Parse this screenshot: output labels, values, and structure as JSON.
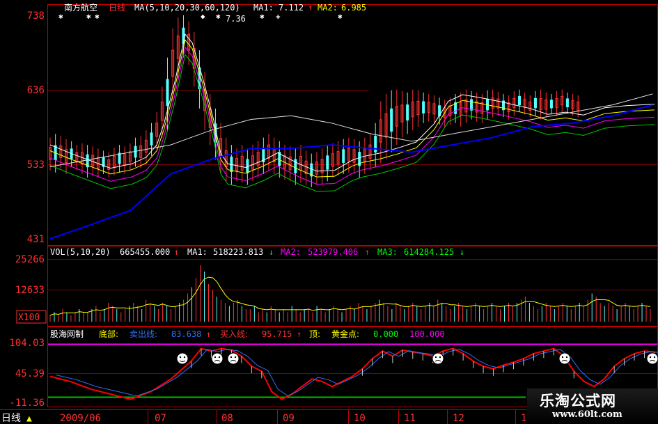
{
  "colors": {
    "frame": "#c00000",
    "ma1": "#ffffff",
    "ma2": "#ffff00",
    "ma3": "#ff00ff",
    "ma4": "#00c800",
    "ma5": "#e0e0e0",
    "ma6": "#0000ff",
    "up": "#ff3232",
    "down": "#54ffff",
    "ind_main": "#ff0000",
    "ind_sub": "#3070ff",
    "ind_top": "#ff00ff",
    "ind_bottom": "#00c000"
  },
  "main_panel": {
    "stock_name": "南方航空",
    "period": "日线",
    "ma_header": "MA(5,10,20,30,60,120)",
    "ma1_label": "MA1:",
    "ma1_value": "7.112",
    "ma1_arrow": "↑",
    "ma2_label": "MA2:",
    "ma2_value": "6.985",
    "peak_label": "7.36",
    "y_ticks": [
      "738",
      "636",
      "533",
      "431"
    ]
  },
  "vol_panel": {
    "header": "VOL(5,10,20)",
    "vol_value": "665455.000",
    "vol_arrow": "↑",
    "ma1_label": "MA1:",
    "ma1_value": "518223.813",
    "ma1_arrow": "↓",
    "ma2_label": "MA2:",
    "ma2_value": "523979.406",
    "ma2_arrow": "↑",
    "ma3_label": "MA3:",
    "ma3_value": "614284.125",
    "ma3_arrow": "↓",
    "y_ticks": [
      "25266",
      "12633"
    ],
    "unit": "X100"
  },
  "indicator_panel": {
    "name": "股海网制",
    "bottom_label": "底部:",
    "sell_label": "卖出线:",
    "sell_value": "83.638",
    "sell_arrow": "↑",
    "buy_label": "买入线:",
    "buy_value": "95.715",
    "buy_arrow": "↑",
    "top_label": "顶:",
    "gold_label": "黄金点:",
    "gold_value": "0.000",
    "extra_value": "100.000",
    "y_ticks": [
      "104.03",
      "45.39",
      "-11.36"
    ]
  },
  "x_axis": {
    "period_button": "日线",
    "labels": [
      "2009/06",
      "07",
      "08",
      "09",
      "10",
      "11",
      "12",
      "1"
    ]
  },
  "watermark": {
    "title": "乐淘公式网",
    "url": "www.60lt.com"
  },
  "chart_data": [
    {
      "type": "candlestick",
      "series": [
        {
          "name": "MA1",
          "values": []
        },
        {
          "name": "MA2",
          "values": []
        }
      ],
      "y_ticks": [
        738,
        636,
        533,
        431
      ],
      "ylim": [
        431,
        738
      ],
      "peak_value": 7.36,
      "grid": true,
      "close_path": [
        [
          0,
          560
        ],
        [
          12,
          548
        ],
        [
          22,
          539
        ],
        [
          34,
          528
        ],
        [
          46,
          534
        ],
        [
          54,
          543
        ],
        [
          60,
          560
        ],
        [
          64,
          589
        ],
        [
          70,
          645
        ],
        [
          76,
          712
        ],
        [
          80,
          700
        ],
        [
          86,
          650
        ],
        [
          92,
          594
        ],
        [
          96,
          548
        ],
        [
          100,
          534
        ],
        [
          110,
          529
        ],
        [
          120,
          539
        ],
        [
          128,
          549
        ],
        [
          140,
          534
        ],
        [
          150,
          524
        ],
        [
          160,
          525
        ],
        [
          170,
          539
        ],
        [
          176,
          544
        ],
        [
          186,
          549
        ],
        [
          196,
          556
        ],
        [
          206,
          564
        ],
        [
          216,
          589
        ],
        [
          224,
          620
        ],
        [
          232,
          629
        ],
        [
          242,
          625
        ],
        [
          254,
          619
        ],
        [
          270,
          610
        ],
        [
          280,
          602
        ],
        [
          290,
          605
        ],
        [
          300,
          601
        ],
        [
          312,
          611
        ],
        [
          324,
          614
        ],
        [
          340,
          616
        ]
      ],
      "wick_spans": [
        [
          0,
          525,
          570
        ],
        [
          3,
          522,
          575
        ],
        [
          6,
          528,
          572
        ],
        [
          9,
          520,
          568
        ],
        [
          12,
          530,
          565
        ],
        [
          15,
          525,
          560
        ],
        [
          18,
          520,
          562
        ],
        [
          21,
          515,
          560
        ],
        [
          24,
          518,
          558
        ],
        [
          27,
          515,
          555
        ],
        [
          30,
          520,
          552
        ],
        [
          33,
          515,
          550
        ],
        [
          36,
          518,
          556
        ],
        [
          39,
          522,
          560
        ],
        [
          42,
          520,
          558
        ],
        [
          45,
          525,
          562
        ],
        [
          48,
          530,
          570
        ],
        [
          51,
          528,
          572
        ],
        [
          54,
          535,
          580
        ],
        [
          57,
          545,
          590
        ],
        [
          60,
          555,
          605
        ],
        [
          63,
          570,
          640
        ],
        [
          66,
          580,
          680
        ],
        [
          69,
          620,
          720
        ],
        [
          72,
          650,
          735
        ],
        [
          75,
          680,
          738
        ],
        [
          78,
          670,
          730
        ],
        [
          81,
          640,
          715
        ],
        [
          84,
          610,
          690
        ],
        [
          87,
          580,
          660
        ],
        [
          90,
          560,
          630
        ],
        [
          93,
          540,
          610
        ],
        [
          96,
          520,
          590
        ],
        [
          99,
          510,
          570
        ],
        [
          102,
          505,
          560
        ],
        [
          105,
          510,
          555
        ],
        [
          108,
          508,
          560
        ],
        [
          111,
          505,
          555
        ],
        [
          114,
          510,
          560
        ],
        [
          117,
          515,
          565
        ],
        [
          120,
          520,
          570
        ],
        [
          123,
          525,
          575
        ],
        [
          126,
          520,
          570
        ],
        [
          129,
          515,
          565
        ],
        [
          132,
          512,
          560
        ],
        [
          135,
          510,
          558
        ],
        [
          138,
          505,
          555
        ],
        [
          141,
          508,
          560
        ],
        [
          144,
          505,
          552
        ],
        [
          147,
          502,
          548
        ],
        [
          150,
          505,
          550
        ],
        [
          153,
          505,
          555
        ],
        [
          156,
          510,
          560
        ],
        [
          159,
          515,
          562
        ],
        [
          162,
          518,
          565
        ],
        [
          165,
          520,
          568
        ],
        [
          168,
          522,
          570
        ],
        [
          171,
          520,
          568
        ],
        [
          174,
          515,
          565
        ],
        [
          177,
          520,
          570
        ],
        [
          180,
          525,
          575
        ],
        [
          183,
          530,
          590
        ],
        [
          186,
          535,
          620
        ],
        [
          189,
          540,
          630
        ],
        [
          192,
          550,
          635
        ],
        [
          195,
          560,
          636
        ],
        [
          198,
          570,
          634
        ],
        [
          201,
          575,
          632
        ],
        [
          204,
          580,
          636
        ],
        [
          207,
          585,
          635
        ],
        [
          210,
          590,
          632
        ],
        [
          213,
          592,
          630
        ],
        [
          216,
          590,
          628
        ],
        [
          219,
          588,
          625
        ],
        [
          222,
          585,
          622
        ],
        [
          225,
          588,
          625
        ],
        [
          228,
          590,
          630
        ],
        [
          231,
          585,
          632
        ],
        [
          234,
          590,
          636
        ],
        [
          237,
          595,
          634
        ],
        [
          240,
          592,
          632
        ],
        [
          243,
          590,
          630
        ],
        [
          246,
          595,
          635
        ],
        [
          249,
          598,
          636
        ],
        [
          252,
          600,
          633
        ],
        [
          255,
          598,
          630
        ],
        [
          258,
          595,
          628
        ],
        [
          261,
          600,
          634
        ],
        [
          264,
          605,
          636
        ],
        [
          267,
          602,
          632
        ],
        [
          270,
          598,
          628
        ],
        [
          273,
          600,
          634
        ],
        [
          276,
          595,
          636
        ],
        [
          279,
          598,
          632
        ],
        [
          282,
          602,
          630
        ],
        [
          285,
          600,
          634
        ],
        [
          288,
          605,
          636
        ],
        [
          291,
          603,
          632
        ],
        [
          294,
          600,
          630
        ],
        [
          297,
          598,
          628
        ]
      ],
      "ma5_path": [
        [
          0,
          530
        ],
        [
          20,
          540
        ],
        [
          40,
          550
        ],
        [
          60,
          560
        ],
        [
          80,
          580
        ],
        [
          100,
          595
        ],
        [
          120,
          600
        ],
        [
          140,
          590
        ],
        [
          160,
          575
        ],
        [
          180,
          565
        ],
        [
          200,
          575
        ],
        [
          220,
          585
        ],
        [
          240,
          595
        ],
        [
          260,
          605
        ],
        [
          280,
          615
        ],
        [
          300,
          630
        ]
      ],
      "ma6_path": [
        [
          0,
          431
        ],
        [
          20,
          450
        ],
        [
          40,
          470
        ],
        [
          60,
          520
        ],
        [
          80,
          540
        ],
        [
          100,
          555
        ],
        [
          120,
          555
        ],
        [
          140,
          560
        ],
        [
          160,
          555
        ],
        [
          180,
          550
        ],
        [
          200,
          560
        ],
        [
          220,
          570
        ],
        [
          240,
          585
        ],
        [
          260,
          590
        ],
        [
          280,
          600
        ],
        [
          300,
          615
        ]
      ]
    },
    {
      "type": "bar",
      "series": [
        {
          "name": "VOL",
          "values": []
        },
        {
          "name": "MA1",
          "values": []
        },
        {
          "name": "MA2",
          "values": []
        },
        {
          "name": "MA3",
          "values": []
        }
      ],
      "y_ticks": [
        25266,
        12633
      ],
      "ylim": [
        0,
        25266
      ],
      "bars": [
        2,
        3,
        2,
        4,
        3,
        2,
        3,
        4,
        3,
        3,
        4,
        5,
        3,
        4,
        6,
        5,
        4,
        3,
        4,
        5,
        6,
        5,
        4,
        7,
        6,
        5,
        4,
        6,
        5,
        4,
        5,
        6,
        7,
        9,
        11,
        14,
        18,
        16,
        12,
        10,
        8,
        7,
        6,
        5,
        6,
        7,
        5,
        4,
        4,
        5,
        3,
        4,
        3,
        5,
        4,
        3,
        4,
        3,
        5,
        4,
        3,
        4,
        4,
        3,
        5,
        4,
        3,
        4,
        5,
        4,
        3,
        4,
        5,
        4,
        6,
        5,
        4,
        5,
        6,
        7,
        6,
        5,
        4,
        6,
        5,
        4,
        5,
        6,
        5,
        4,
        5,
        6,
        5,
        7,
        6,
        5,
        4,
        5,
        6,
        5,
        4,
        5,
        6,
        5,
        4,
        5,
        6,
        5,
        4,
        5,
        6,
        5,
        6,
        7,
        8,
        6,
        5,
        4,
        5,
        6,
        5,
        4,
        5,
        6,
        5,
        4,
        5,
        6,
        5,
        7,
        9,
        8,
        6,
        5,
        6,
        5,
        4,
        5,
        6,
        5,
        4,
        5,
        6,
        5,
        4
      ]
    },
    {
      "type": "line",
      "series": [
        {
          "name": "卖出线",
          "values": []
        },
        {
          "name": "买入线",
          "values": []
        }
      ],
      "y_ticks": [
        104.03,
        45.39,
        -11.36
      ],
      "ylim": [
        -11.36,
        104.03
      ],
      "main_path": [
        [
          0,
          40
        ],
        [
          10,
          30
        ],
        [
          20,
          15
        ],
        [
          30,
          5
        ],
        [
          40,
          -5
        ],
        [
          50,
          10
        ],
        [
          60,
          35
        ],
        [
          70,
          70
        ],
        [
          75,
          95
        ],
        [
          80,
          90
        ],
        [
          85,
          95
        ],
        [
          90,
          92
        ],
        [
          95,
          80
        ],
        [
          100,
          60
        ],
        [
          105,
          50
        ],
        [
          110,
          10
        ],
        [
          115,
          -5
        ],
        [
          120,
          5
        ],
        [
          125,
          20
        ],
        [
          130,
          35
        ],
        [
          135,
          30
        ],
        [
          140,
          20
        ],
        [
          145,
          30
        ],
        [
          150,
          40
        ],
        [
          155,
          55
        ],
        [
          160,
          75
        ],
        [
          165,
          90
        ],
        [
          170,
          80
        ],
        [
          175,
          92
        ],
        [
          180,
          88
        ],
        [
          185,
          85
        ],
        [
          190,
          80
        ],
        [
          195,
          90
        ],
        [
          200,
          95
        ],
        [
          205,
          85
        ],
        [
          210,
          70
        ],
        [
          215,
          60
        ],
        [
          220,
          55
        ],
        [
          225,
          62
        ],
        [
          230,
          68
        ],
        [
          235,
          75
        ],
        [
          240,
          85
        ],
        [
          245,
          90
        ],
        [
          250,
          95
        ],
        [
          255,
          80
        ],
        [
          260,
          50
        ],
        [
          265,
          30
        ],
        [
          270,
          20
        ],
        [
          275,
          35
        ],
        [
          280,
          60
        ],
        [
          285,
          75
        ],
        [
          290,
          85
        ],
        [
          295,
          90
        ],
        [
          300,
          88
        ]
      ]
    }
  ]
}
